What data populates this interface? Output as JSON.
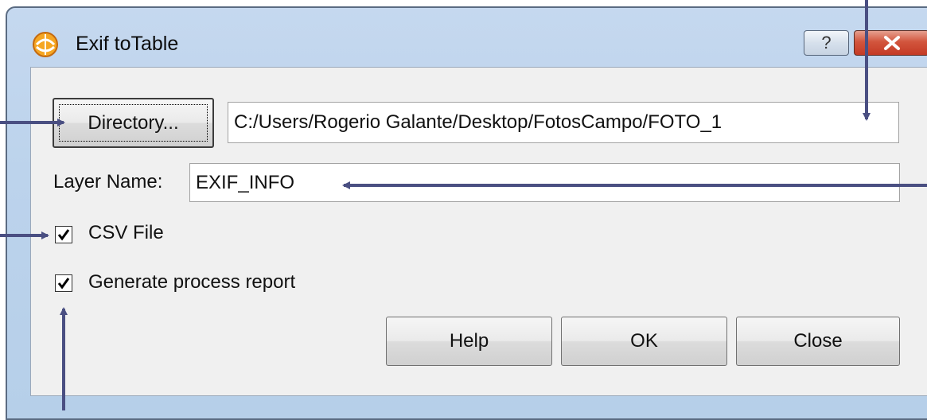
{
  "window": {
    "title": "Exif toTable",
    "help_button_glyph": "?",
    "close_button_glyph": "X",
    "icon": "app-logo-icon"
  },
  "form": {
    "directory_button_label": "Directory...",
    "directory_value": "C:/Users/Rogerio Galante/Desktop/FotosCampo/FOTO_1",
    "layer_name_label": "Layer Name:",
    "layer_name_value": "EXIF_INFO",
    "csv_file": {
      "label": "CSV File",
      "checked": true
    },
    "process_report": {
      "label": "Generate process report",
      "checked": true
    }
  },
  "buttons": {
    "help": "Help",
    "ok": "OK",
    "close": "Close"
  },
  "colors": {
    "arrow": "#4a4f82",
    "frame": "#bcd3ec",
    "close_red": "#c43a25"
  }
}
